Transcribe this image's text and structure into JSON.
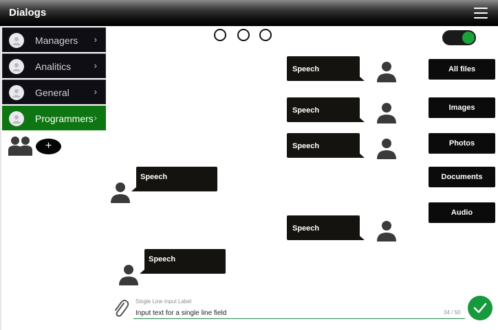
{
  "header": {
    "title": "Dialogs",
    "menu_icon": "hamburger-menu-icon"
  },
  "sidebar": {
    "items": [
      {
        "label": "Managers",
        "active": false
      },
      {
        "label": "Analitics",
        "active": false
      },
      {
        "label": "General",
        "active": false
      },
      {
        "label": "Programmers",
        "active": true
      }
    ],
    "group_icon": "group-users-icon",
    "add_label": "+"
  },
  "pagination": {
    "dots": 3
  },
  "toggle": {
    "state": "on",
    "color": "#1aa33a"
  },
  "messages": [
    {
      "text": "Speech",
      "side": "outgoing"
    },
    {
      "text": "Speech",
      "side": "outgoing"
    },
    {
      "text": "Speech",
      "side": "outgoing"
    },
    {
      "text": "Speech",
      "side": "incoming"
    },
    {
      "text": "Speech",
      "side": "outgoing"
    },
    {
      "text": "Speech",
      "side": "incoming"
    }
  ],
  "file_filters": [
    "All files",
    "Images",
    "Photos",
    "Documents",
    "Audio"
  ],
  "composer": {
    "label": "Single Line Input Label",
    "value": "Input text for a single line field",
    "counter": "34 / 50",
    "attach_icon": "paperclip-icon",
    "send_icon": "checkmark-icon"
  },
  "colors": {
    "header": "#000000",
    "active_item": "#0d7512",
    "send_button": "#169a3d",
    "bubble": "#15130f"
  }
}
